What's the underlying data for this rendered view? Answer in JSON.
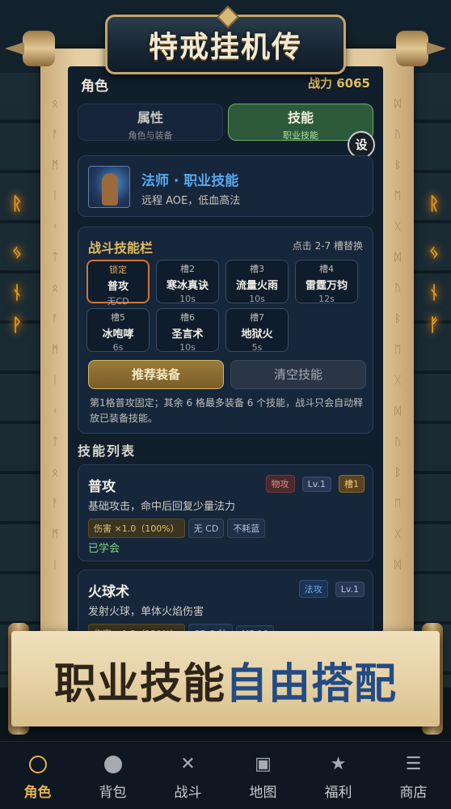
{
  "app": {
    "title": "特戒挂机传"
  },
  "header": {
    "section": "角色",
    "power": "战力 6065"
  },
  "tabs": [
    {
      "label": "属性",
      "sub": "角色与装备"
    },
    {
      "label": "技能",
      "sub": "职业技能"
    }
  ],
  "settings_label": "设",
  "class_card": {
    "name": "法师 · 职业技能",
    "desc": "远程 AOE，低血高法"
  },
  "skillbar": {
    "title": "战斗技能栏",
    "hint": "点击 2-7 槽替换",
    "slots": [
      {
        "label": "锁定",
        "name": "普攻",
        "cd": "无CD"
      },
      {
        "label": "槽2",
        "name": "寒冰真诀",
        "cd": "10s"
      },
      {
        "label": "槽3",
        "name": "流量火雨",
        "cd": "10s"
      },
      {
        "label": "槽4",
        "name": "雷霆万钧",
        "cd": "12s"
      },
      {
        "label": "槽5",
        "name": "冰咆哮",
        "cd": "6s"
      },
      {
        "label": "槽6",
        "name": "圣言术",
        "cd": "10s"
      },
      {
        "label": "槽7",
        "name": "地狱火",
        "cd": "5s"
      }
    ],
    "recommend_label": "推荐装备",
    "clear_label": "清空技能",
    "note": "第1格普攻固定；其余 6 格最多装备 6 个技能，战斗只会自动释放已装备技能。"
  },
  "skill_list": {
    "title": "技能列表",
    "items": [
      {
        "name": "普攻",
        "tags": [
          "物攻",
          "Lv.1",
          "槽1"
        ],
        "desc": "基础攻击，命中后回复少量法力",
        "chips": [
          "伤害 ×1.0（100%）",
          "无 CD",
          "不耗蓝"
        ],
        "status": "已学会"
      },
      {
        "name": "火球术",
        "tags": [
          "法攻",
          "Lv.1"
        ],
        "desc": "发射火球，单体火焰伤害",
        "chips": [
          "伤害 ×1.2（120%）",
          "CD 3 秒",
          "MP 10"
        ]
      }
    ]
  },
  "banner": {
    "part1": "职业技能",
    "part2": "自由搭配"
  },
  "nav": [
    {
      "label": "角色",
      "icon": "circle-outline-icon"
    },
    {
      "label": "背包",
      "icon": "circle-filled-icon"
    },
    {
      "label": "战斗",
      "icon": "cross-icon"
    },
    {
      "label": "地图",
      "icon": "square-icon"
    },
    {
      "label": "福利",
      "icon": "star-icon"
    },
    {
      "label": "商店",
      "icon": "menu-icon"
    }
  ],
  "colors": {
    "accent": "#e5b24e",
    "skill_blue": "#57a9ee",
    "learned_green": "#7dd67f"
  }
}
